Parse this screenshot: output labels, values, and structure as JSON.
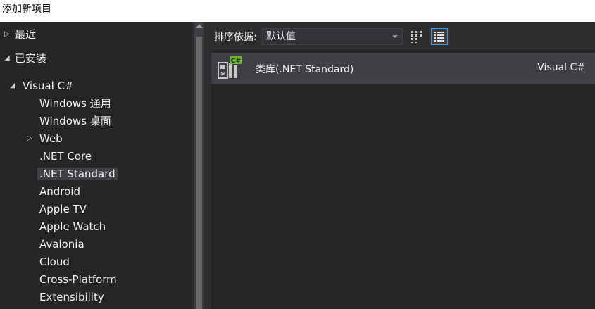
{
  "dialog": {
    "title": "添加新项目"
  },
  "tree": {
    "recent": "最近",
    "installed": "已安装",
    "visual_csharp": "Visual C#",
    "children": [
      "Windows 通用",
      "Windows 桌面",
      "Web",
      ".NET Core",
      ".NET Standard",
      "Android",
      "Apple TV",
      "Apple Watch",
      "Avalonia",
      "Cloud",
      "Cross-Platform",
      "Extensibility"
    ],
    "selected": ".NET Standard"
  },
  "toolbar": {
    "sort_label": "排序依据:",
    "sort_value": "默认值",
    "grid_view_icon": "grid-view-icon",
    "list_view_icon": "list-view-icon"
  },
  "templates": [
    {
      "name": "类库(.NET Standard)",
      "language": "Visual C#",
      "icon": "class-library-csharp-icon",
      "badge": "C#"
    }
  ],
  "colors": {
    "background": "#2d2d30",
    "tree_background": "#252526",
    "selection": "#3f3f46",
    "accent": "#3399ff",
    "csharp_badge": "#68b723"
  }
}
